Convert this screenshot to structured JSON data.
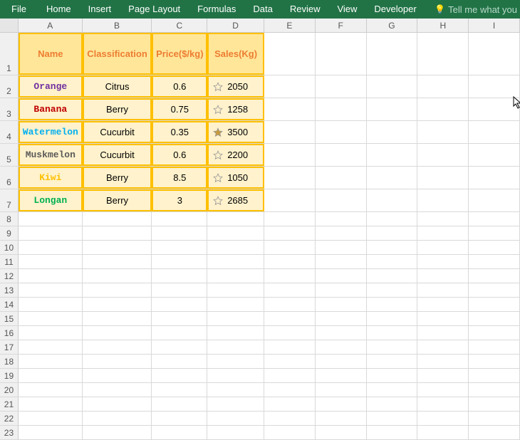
{
  "ribbon": {
    "file": "File",
    "home": "Home",
    "insert": "Insert",
    "pageLayout": "Page Layout",
    "formulas": "Formulas",
    "data": "Data",
    "review": "Review",
    "view": "View",
    "developer": "Developer",
    "tellMe": "Tell me what you"
  },
  "columns": [
    "A",
    "B",
    "C",
    "D",
    "E",
    "F",
    "G",
    "H",
    "I"
  ],
  "rows": [
    "1",
    "2",
    "3",
    "4",
    "5",
    "6",
    "7",
    "8",
    "9",
    "10",
    "11",
    "12",
    "13",
    "14",
    "15",
    "16",
    "17",
    "18",
    "19",
    "20",
    "21",
    "22",
    "23"
  ],
  "table": {
    "headers": {
      "name": "Name",
      "classification": "Classification",
      "price": "Price($/kg)",
      "sales": "Sales(Kg)"
    },
    "data": [
      {
        "name": "Orange",
        "name_color": "#7030a0",
        "classification": "Citrus",
        "price": "0.6",
        "sales": "2050",
        "star_filled": false
      },
      {
        "name": "Banana",
        "name_color": "#c00000",
        "classification": "Berry",
        "price": "0.75",
        "sales": "1258",
        "star_filled": false
      },
      {
        "name": "Watermelon",
        "name_color": "#00b0f0",
        "classification": "Cucurbit",
        "price": "0.35",
        "sales": "3500",
        "star_filled": true
      },
      {
        "name": "Muskmelon",
        "name_color": "#595959",
        "classification": "Cucurbit",
        "price": "0.6",
        "sales": "2200",
        "star_filled": false
      },
      {
        "name": "Kiwi",
        "name_color": "#ffc000",
        "classification": "Berry",
        "price": "8.5",
        "sales": "1050",
        "star_filled": false
      },
      {
        "name": "Longan",
        "name_color": "#00b050",
        "classification": "Berry",
        "price": "3",
        "sales": "2685",
        "star_filled": false
      }
    ]
  },
  "chart_data": {
    "type": "table",
    "title": "",
    "columns": [
      "Name",
      "Classification",
      "Price($/kg)",
      "Sales(Kg)"
    ],
    "rows": [
      [
        "Orange",
        "Citrus",
        0.6,
        2050
      ],
      [
        "Banana",
        "Berry",
        0.75,
        1258
      ],
      [
        "Watermelon",
        "Cucurbit",
        0.35,
        3500
      ],
      [
        "Muskmelon",
        "Cucurbit",
        0.6,
        2200
      ],
      [
        "Kiwi",
        "Berry",
        8.5,
        1050
      ],
      [
        "Longan",
        "Berry",
        3,
        2685
      ]
    ]
  }
}
